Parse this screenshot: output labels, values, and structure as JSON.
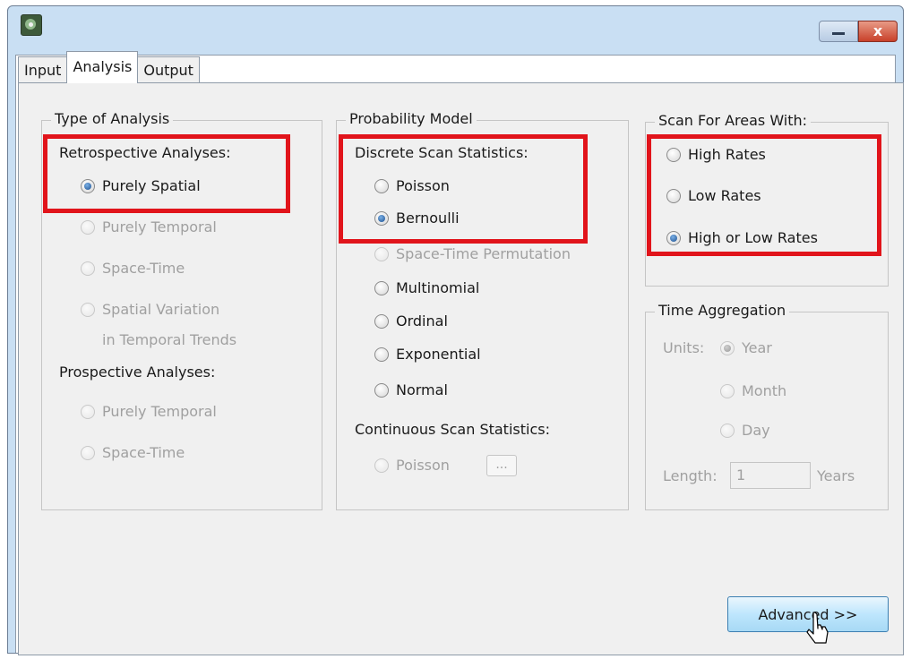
{
  "window": {
    "icon": "app-icon",
    "minimize_icon": "minimize-icon",
    "close_label": "x"
  },
  "tabs": [
    {
      "label": "Input"
    },
    {
      "label": "Analysis",
      "active": true
    },
    {
      "label": "Output"
    }
  ],
  "type_of_analysis": {
    "title": "Type of Analysis",
    "retrospective_label": "Retrospective Analyses:",
    "purely_spatial": "Purely Spatial",
    "purely_temporal": "Purely Temporal",
    "space_time": "Space-Time",
    "spatial_variation_1": "Spatial Variation",
    "spatial_variation_2": "in Temporal Trends",
    "prospective_label": "Prospective Analyses:",
    "prosp_purely_temporal": "Purely Temporal",
    "prosp_space_time": "Space-Time"
  },
  "probability_model": {
    "title": "Probability Model",
    "discrete_label": "Discrete Scan Statistics:",
    "poisson": "Poisson",
    "bernoulli": "Bernoulli",
    "space_time_permutation": "Space-Time Permutation",
    "multinomial": "Multinomial",
    "ordinal": "Ordinal",
    "exponential": "Exponential",
    "normal": "Normal",
    "continuous_label": "Continuous Scan Statistics:",
    "cont_poisson": "Poisson",
    "dots_label": "..."
  },
  "scan_for": {
    "title": "Scan For Areas With:",
    "high": "High Rates",
    "low": "Low Rates",
    "high_or_low": "High or Low Rates"
  },
  "time_aggregation": {
    "title": "Time Aggregation",
    "units_label": "Units:",
    "year": "Year",
    "month": "Month",
    "day": "Day",
    "length_label": "Length:",
    "length_value": "1",
    "years_label": "Years"
  },
  "advanced_label": "Advanced >>",
  "colors": {
    "highlight": "#e1141b",
    "disabled_text": "#a0a0a0",
    "selected_radio": "#1c4f8f"
  }
}
